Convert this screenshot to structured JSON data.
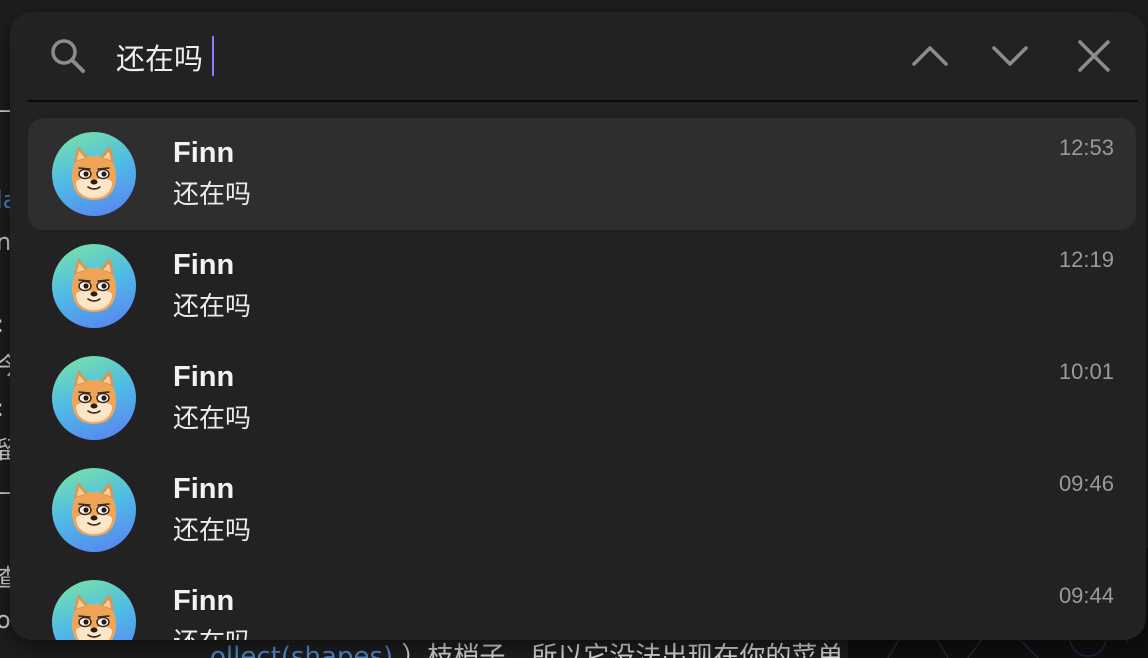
{
  "search": {
    "query": "还在吗"
  },
  "results": [
    {
      "name": "Finn",
      "message": "还在吗",
      "time": "12:53",
      "selected": true
    },
    {
      "name": "Finn",
      "message": "还在吗",
      "time": "12:19",
      "selected": false
    },
    {
      "name": "Finn",
      "message": "还在吗",
      "time": "10:01",
      "selected": false
    },
    {
      "name": "Finn",
      "message": "还在吗",
      "time": "09:46",
      "selected": false
    },
    {
      "name": "Finn",
      "message": "还在吗",
      "time": "09:44",
      "selected": false
    }
  ],
  "icons": {
    "search": "search-icon",
    "previous": "chevron-up-icon",
    "next": "chevron-down-icon",
    "close": "close-icon",
    "avatar": "shiba-dog-avatar"
  },
  "colors": {
    "popup_background": "#222222",
    "selected_row": "#2e2e2e",
    "caret": "#8a7cff",
    "icon": "#8c8c8c",
    "time_text": "#9a9a9a"
  }
}
